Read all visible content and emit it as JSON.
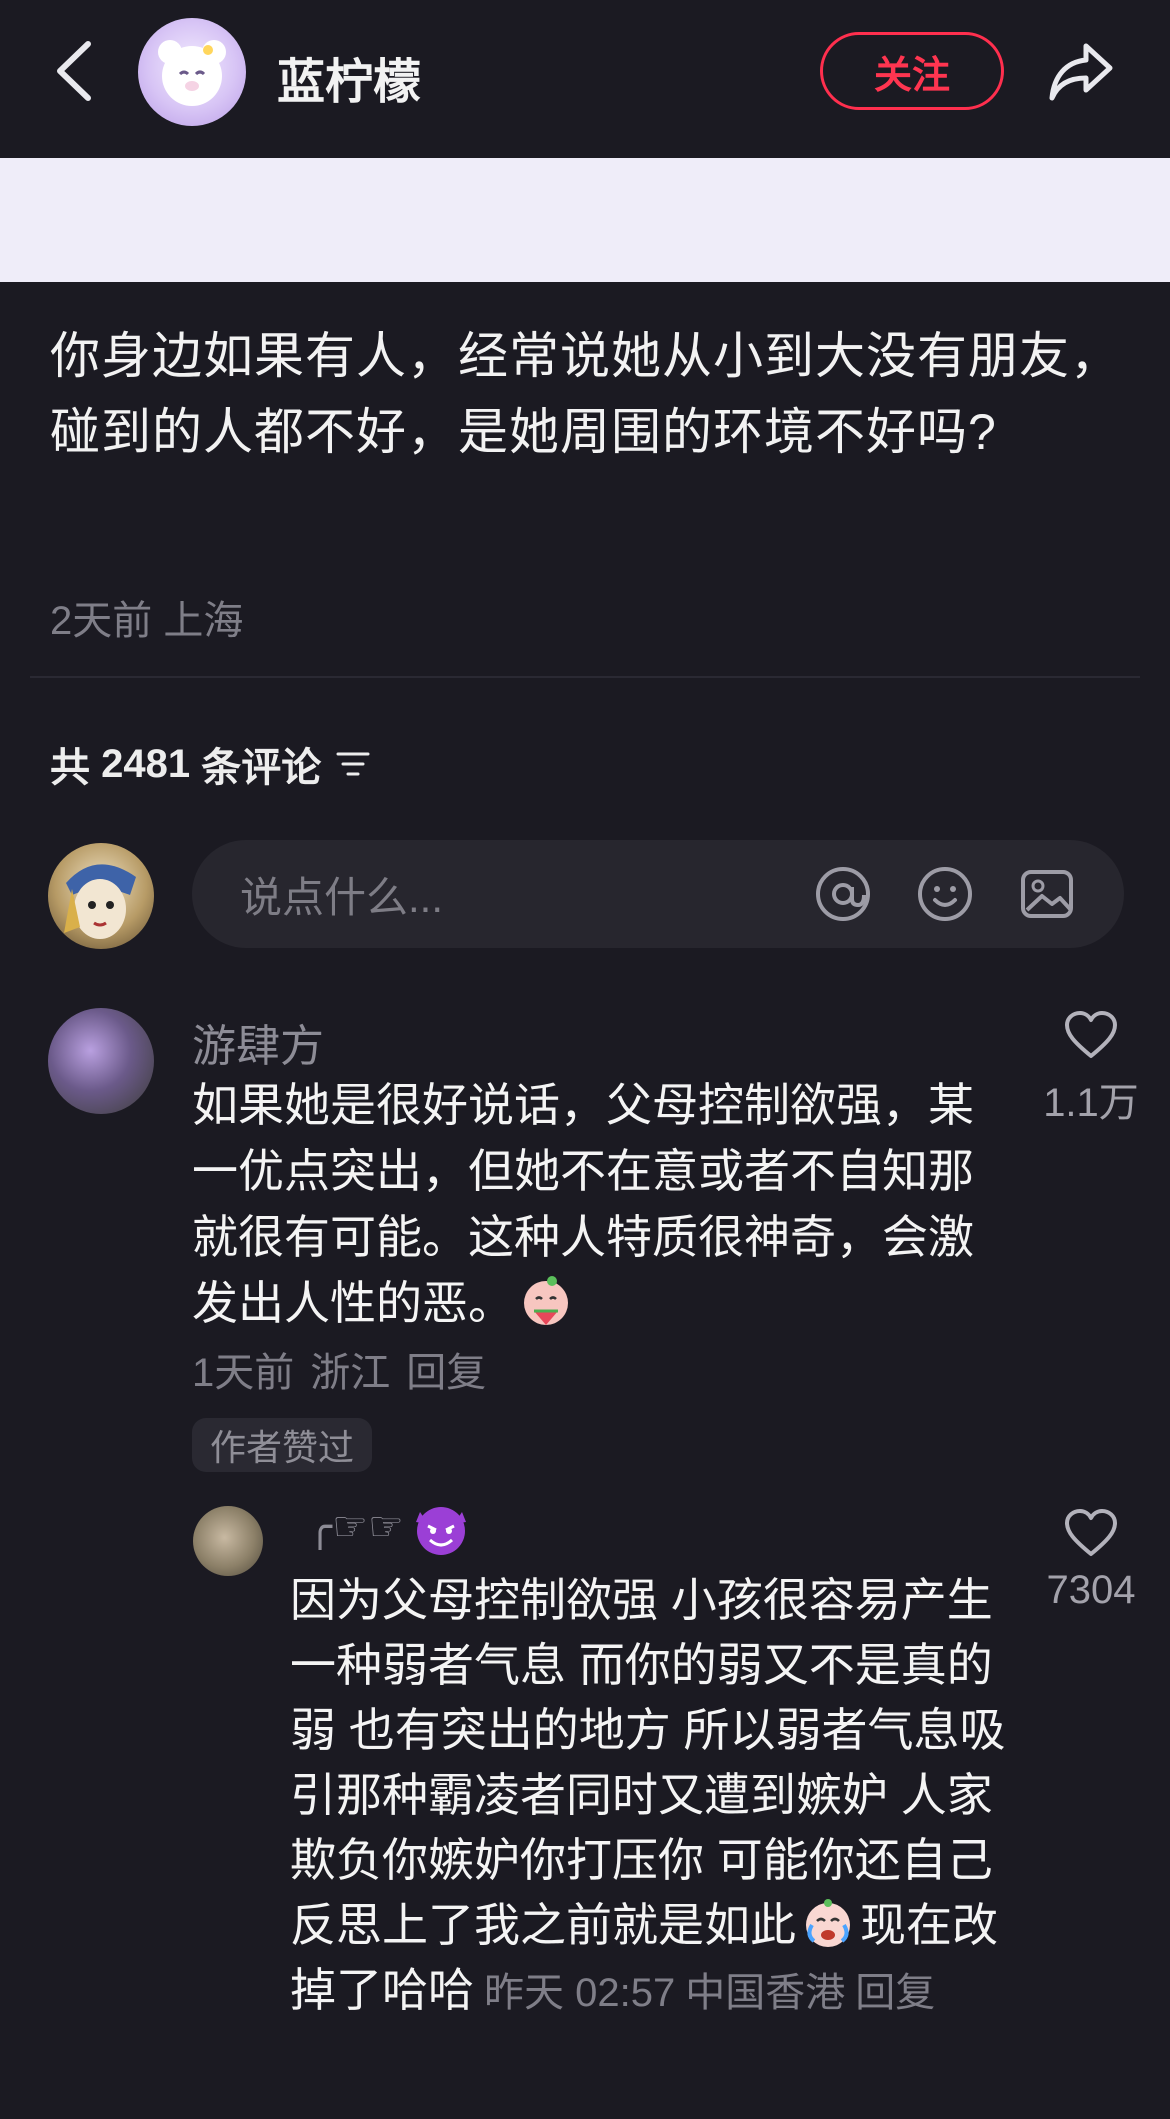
{
  "header": {
    "username": "蓝柠檬",
    "follow_label": "关注"
  },
  "post": {
    "text": "你身边如果有人，经常说她从小到大没有朋友，碰到的人都不好，是她周围的环境不好吗?",
    "time": "2天前",
    "location": "上海"
  },
  "comments_header": {
    "prefix": "共",
    "count": "2481",
    "suffix": "条评论"
  },
  "composer": {
    "placeholder": "说点什么..."
  },
  "comment": {
    "author": "游肆方",
    "text": "如果她是很好说话，父母控制欲强，某一优点突出，但她不在意或者不自知那就很有可能。这种人特质很神奇，会激发出人性的恶。",
    "time": "1天前",
    "location": "浙江",
    "reply_label": "回复",
    "badge": "作者赞过",
    "likes": "1.1万"
  },
  "reply": {
    "author": "╭☞☞",
    "text_part1": "因为父母控制欲强 小孩很容易产生一种弱者气息 而你的弱又不是真的弱 也有突出的地方 所以弱者气息吸引那种霸凌者同时又遭到嫉妒 人家欺负你嫉妒你打压你 可能你还自己反思上了我之前就是如此",
    "text_part2": "现在改掉了哈哈",
    "time": "昨天 02:57",
    "location": "中国香港",
    "reply_label": "回复",
    "likes": "7304"
  },
  "colors": {
    "background": "#1b1a22",
    "accent_red": "#ff2f4e",
    "banner": "#efedf9",
    "muted_text": "#7f7e88"
  },
  "icons": [
    "back-arrow-icon",
    "share-icon",
    "filter-icon",
    "at-icon",
    "emoji-icon",
    "image-icon",
    "heart-icon",
    "devil-emoji-icon",
    "watermelon-emoji-icon",
    "crying-emoji-icon"
  ]
}
